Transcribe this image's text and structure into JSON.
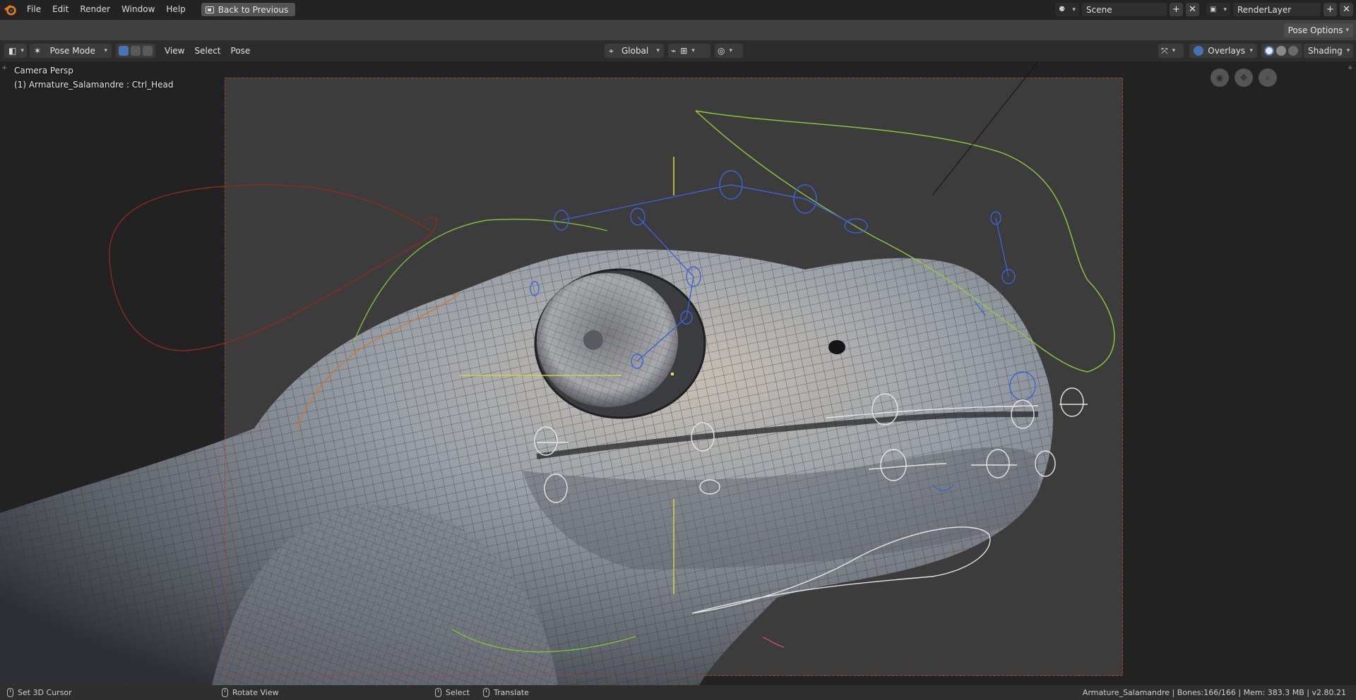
{
  "topbar": {
    "menus": [
      "File",
      "Edit",
      "Render",
      "Window",
      "Help"
    ],
    "back_button": "Back to Previous",
    "scene_name": "Scene",
    "render_layer": "RenderLayer"
  },
  "subbar": {
    "pose_options": "Pose Options"
  },
  "viewport_header": {
    "mode": "Pose Mode",
    "menus": [
      "View",
      "Select",
      "Pose"
    ],
    "transform_orientation": "Global",
    "overlays": "Overlays",
    "shading": "Shading"
  },
  "viewport": {
    "camera_label": "Camera Persp",
    "object_label": "(1) Armature_Salamandre : Ctrl_Head"
  },
  "statusbar": {
    "set_cursor": "Set 3D Cursor",
    "rotate_view": "Rotate View",
    "select": "Select",
    "translate": "Translate",
    "info": "Armature_Salamandre | Bones:166/166  | Mem: 383.3 MB | v2.80.21"
  },
  "colors": {
    "accent": "#4772b3",
    "ui_dark": "#232323",
    "viewport_bg": "#393939",
    "camera_frame": "#d0302a"
  }
}
